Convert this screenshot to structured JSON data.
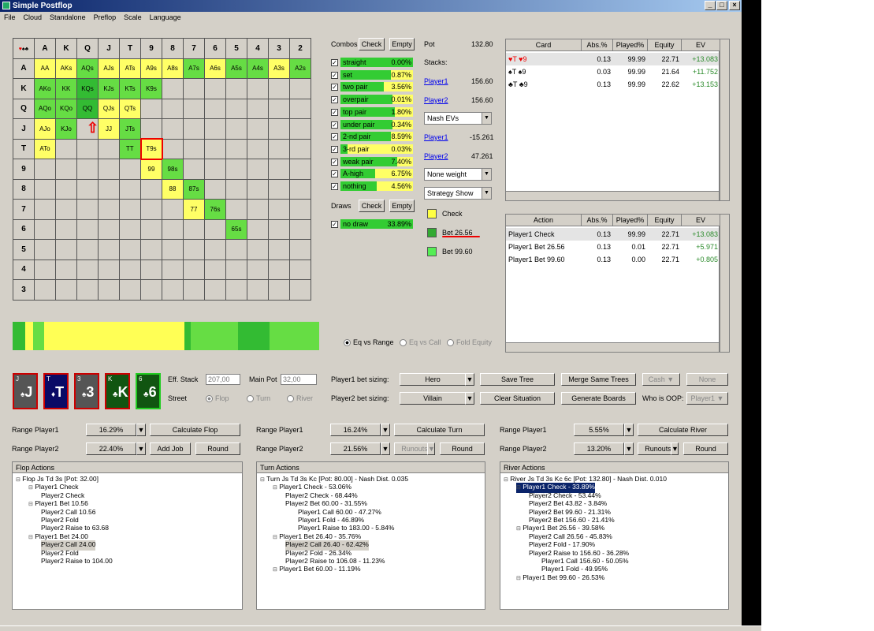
{
  "window": {
    "title": "Simple Postflop",
    "menu": [
      "File",
      "Cloud",
      "Standalone",
      "Preflop",
      "Scale",
      "Language"
    ]
  },
  "grid": {
    "cols": [
      "A",
      "K",
      "Q",
      "J",
      "T",
      "9",
      "8",
      "7",
      "6",
      "5",
      "4",
      "3",
      "2"
    ],
    "rows": [
      "A",
      "K",
      "Q",
      "J",
      "T",
      "9",
      "8",
      "7",
      "6",
      "5",
      "4",
      "3",
      "2"
    ],
    "cells": [
      [
        "AA",
        "AKs",
        "AQs",
        "AJs",
        "ATs",
        "A9s",
        "A8s",
        "A7s",
        "A6s",
        "A5s",
        "A4s",
        "A3s",
        "A2s"
      ],
      [
        "AKo",
        "KK",
        "KQs",
        "KJs",
        "KTs",
        "K9s",
        "",
        "",
        "",
        "",
        "",
        "",
        ""
      ],
      [
        "AQo",
        "KQo",
        "QQ",
        "QJs",
        "QTs",
        "",
        "",
        "",
        "",
        "",
        "",
        "",
        ""
      ],
      [
        "AJo",
        "KJo",
        "",
        "JJ",
        "JTs",
        "",
        "",
        "",
        "",
        "",
        "",
        "",
        ""
      ],
      [
        "ATo",
        "",
        "",
        "",
        "TT",
        "T9s",
        "",
        "",
        "",
        "",
        "",
        "",
        ""
      ],
      [
        "",
        "",
        "",
        "",
        "",
        "99",
        "98s",
        "",
        "",
        "",
        "",
        "",
        ""
      ],
      [
        "",
        "",
        "",
        "",
        "",
        "",
        "88",
        "87s",
        "",
        "",
        "",
        "",
        ""
      ],
      [
        "",
        "",
        "",
        "",
        "",
        "",
        "",
        "77",
        "76s",
        "",
        "",
        "",
        ""
      ],
      [
        "",
        "",
        "",
        "",
        "",
        "",
        "",
        "",
        "",
        "65s",
        "",
        "",
        ""
      ],
      [
        "",
        "",
        "",
        "",
        "",
        "",
        "",
        "",
        "",
        "",
        "",
        "",
        ""
      ],
      [
        "",
        "",
        "",
        "",
        "",
        "",
        "",
        "",
        "",
        "",
        "",
        "",
        ""
      ],
      [
        "",
        "",
        "",
        "",
        "",
        "",
        "",
        "",
        "",
        "",
        "",
        "",
        ""
      ]
    ]
  },
  "combos": {
    "label": "Combos",
    "check": "Check",
    "empty": "Empty",
    "items": [
      {
        "name": "straight",
        "pct": "0.00%",
        "g": 1.0
      },
      {
        "name": "set",
        "pct": "0.87%",
        "g": 0.7
      },
      {
        "name": "two pair",
        "pct": "3.56%",
        "g": 0.6
      },
      {
        "name": "overpair",
        "pct": "0.01%",
        "g": 0.72
      },
      {
        "name": "top pair",
        "pct": "1.80%",
        "g": 0.75
      },
      {
        "name": "under pair",
        "pct": "0.34%",
        "g": 0.72
      },
      {
        "name": "2-nd pair",
        "pct": "8.59%",
        "g": 0.7
      },
      {
        "name": "3-rd pair",
        "pct": "0.03%",
        "g": 0.1
      },
      {
        "name": "weak pair",
        "pct": "7.40%",
        "g": 0.78
      },
      {
        "name": "A-high",
        "pct": "6.75%",
        "g": 0.48
      },
      {
        "name": "nothing",
        "pct": "4.56%",
        "g": 0.5
      }
    ]
  },
  "draws": {
    "label": "Draws",
    "check": "Check",
    "empty": "Empty",
    "items": [
      {
        "name": "no draw",
        "pct": "33.89%",
        "g": 1.0
      }
    ]
  },
  "pot": {
    "label": "Pot",
    "value": "132.80",
    "stacks": "Stacks:",
    "p1": "Player1",
    "p1v": "156.60",
    "p2": "Player2",
    "p2v": "156.60",
    "nash": "Nash EVs",
    "p1ev": "-15.261",
    "p2ev": "47.261",
    "weight": "None weight",
    "strategy": "Strategy Show"
  },
  "legend": [
    {
      "label": "Check",
      "color": "#ffff44"
    },
    {
      "label": "Bet 26.56",
      "color": "#33aa33"
    },
    {
      "label": "Bet 99.60",
      "color": "#55ee55"
    }
  ],
  "cardtable": {
    "headers": [
      "Card",
      "Abs.%",
      "Played%",
      "Equity",
      "EV"
    ],
    "rows": [
      [
        "♥T ♥9",
        "0.13",
        "99.99",
        "22.71",
        "+13.083"
      ],
      [
        "♠T ♠9",
        "0.03",
        "99.99",
        "21.64",
        "+11.752"
      ],
      [
        "♣T ♣9",
        "0.13",
        "99.99",
        "22.62",
        "+13.153"
      ]
    ]
  },
  "actiontable": {
    "headers": [
      "Action",
      "Abs.%",
      "Played%",
      "Equity",
      "EV"
    ],
    "rows": [
      [
        "Player1 Check",
        "0.13",
        "99.99",
        "22.71",
        "+13.083"
      ],
      [
        "Player1 Bet 26.56",
        "0.13",
        "0.01",
        "22.71",
        "+5.971"
      ],
      [
        "Player1 Bet 99.60",
        "0.13",
        "0.00",
        "22.71",
        "+0.805"
      ]
    ]
  },
  "eqmode": [
    "Eq vs Range",
    "Eq vs Call",
    "Fold Equity"
  ],
  "board": [
    {
      "rank": "J",
      "suit": "♠"
    },
    {
      "rank": "T",
      "suit": "♦"
    },
    {
      "rank": "3",
      "suit": "♠"
    },
    {
      "rank": "K",
      "suit": "♣"
    },
    {
      "rank": "6",
      "suit": "♣"
    }
  ],
  "settings": {
    "eff_stack_label": "Eff. Stack",
    "eff_stack": "207,00",
    "main_pot_label": "Main Pot",
    "main_pot": "32,00",
    "street": "Street",
    "flop": "Flop",
    "turn": "Turn",
    "river": "River",
    "p1_bet": "Player1 bet sizing:",
    "p2_bet": "Player2 bet sizing:",
    "hero": "Hero",
    "villain": "Villain",
    "save_tree": "Save Tree",
    "clear": "Clear Situation",
    "merge": "Merge Same Trees",
    "gen": "Generate Boards",
    "cash": "Cash",
    "none": "None",
    "who_oop": "Who is OOP:",
    "oop": "Player1"
  },
  "ranges": [
    {
      "p1": "Range Player1",
      "p1v": "16.29%",
      "p2": "Range Player2",
      "p2v": "22.40%",
      "calc": "Calculate Flop",
      "b2": "Add Job",
      "b3": "Round"
    },
    {
      "p1": "Range Player1",
      "p1v": "16.24%",
      "p2": "Range Player2",
      "p2v": "21.56%",
      "calc": "Calculate Turn",
      "b2": "Runouts",
      "b3": "Round"
    },
    {
      "p1": "Range Player1",
      "p1v": "5.55%",
      "p2": "Range Player2",
      "p2v": "13.20%",
      "calc": "Calculate River",
      "b2": "Runouts",
      "b3": "Round"
    }
  ],
  "flop": {
    "title": "Flop Actions",
    "lines": [
      "Flop Js Td 3s [Pot: 32.00]",
      "Player1 Check",
      "Player2 Check",
      "Player1 Bet 10.56",
      "Player2 Call 10.56",
      "Player2 Fold",
      "Player2 Raise to 63.68",
      "Player1 Bet 24.00",
      "Player2 Call 24.00",
      "Player2 Fold",
      "Player2 Raise to 104.00"
    ]
  },
  "turn": {
    "title": "Turn Actions",
    "lines": [
      "Turn Js Td 3s Kc [Pot: 80.00] - Nash Dist. 0.035",
      "Player1 Check - 53.06%",
      "Player2 Check - 68.44%",
      "Player2 Bet 60.00 - 31.55%",
      "Player1 Call 60.00 - 47.27%",
      "Player1 Fold - 46.89%",
      "Player1 Raise to 183.00 - 5.84%",
      "Player1 Bet 26.40 - 35.76%",
      "Player2 Call 26.40 - 62.42%",
      "Player2 Fold - 26.34%",
      "Player2 Raise to 106.08 - 11.23%",
      "Player1 Bet 60.00 - 11.19%"
    ]
  },
  "river": {
    "title": "River Actions",
    "lines": [
      "River Js Td 3s Kc 6c [Pot: 132.80] - Nash Dist. 0.010",
      "Player1 Check - 33.89%",
      "Player2 Check - 53.44%",
      "Player2 Bet 43.82 - 3.84%",
      "Player2 Bet 99.60 - 21.31%",
      "Player2 Bet 156.60 - 21.41%",
      "Player1 Bet 26.56 - 39.58%",
      "Player2 Call 26.56 - 45.83%",
      "Player2 Fold - 17.90%",
      "Player2 Raise to 156.60 - 36.28%",
      "Player1 Call 156.60 - 50.05%",
      "Player1 Fold - 49.95%",
      "Player1 Bet 99.60 - 26.53%"
    ]
  }
}
